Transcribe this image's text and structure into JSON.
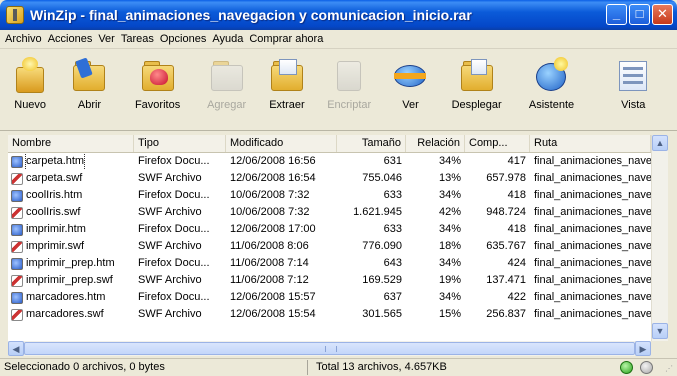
{
  "window": {
    "title": "WinZip - final_animaciones_navegacion y comunicacion_inicio.rar",
    "buttons": [
      "_",
      "□",
      "✕"
    ]
  },
  "menu": [
    "Archivo",
    "Acciones",
    "Ver",
    "Tareas",
    "Opciones",
    "Ayuda",
    "Comprar ahora"
  ],
  "toolbar": [
    {
      "label": "Nuevo",
      "icon": "new-archive-icon",
      "enabled": true
    },
    {
      "label": "Abrir",
      "icon": "open-folder-icon",
      "enabled": true
    },
    {
      "label": "Favoritos",
      "icon": "favorites-heart-icon",
      "enabled": true
    },
    {
      "label": "Agregar",
      "icon": "add-files-icon",
      "enabled": false
    },
    {
      "label": "Extraer",
      "icon": "extract-folder-icon",
      "enabled": true
    },
    {
      "label": "Encriptar",
      "icon": "encrypt-icon",
      "enabled": false
    },
    {
      "label": "Ver",
      "icon": "view-glasses-icon",
      "enabled": true
    },
    {
      "label": "Desplegar",
      "icon": "checkout-icon",
      "enabled": true
    },
    {
      "label": "Asistente",
      "icon": "wizard-icon",
      "enabled": true
    },
    {
      "label": "Vista",
      "icon": "view-layout-icon",
      "enabled": true
    }
  ],
  "columns": [
    "Nombre",
    "Tipo",
    "Modificado",
    "Tamaño",
    "Relación",
    "Comp...",
    "Ruta"
  ],
  "files": [
    {
      "name": "carpeta.htm",
      "type": "Firefox Docu...",
      "modified": "12/06/2008 16:56",
      "size": "631",
      "ratio": "34%",
      "packed": "417",
      "path": "final_animaciones_naveg",
      "kind": "htm"
    },
    {
      "name": "carpeta.swf",
      "type": "SWF Archivo",
      "modified": "12/06/2008 16:54",
      "size": "755.046",
      "ratio": "13%",
      "packed": "657.978",
      "path": "final_animaciones_naveg",
      "kind": "swf"
    },
    {
      "name": "coolIris.htm",
      "type": "Firefox Docu...",
      "modified": "10/06/2008 7:32",
      "size": "633",
      "ratio": "34%",
      "packed": "418",
      "path": "final_animaciones_naveg",
      "kind": "htm"
    },
    {
      "name": "coolIris.swf",
      "type": "SWF Archivo",
      "modified": "10/06/2008 7:32",
      "size": "1.621.945",
      "ratio": "42%",
      "packed": "948.724",
      "path": "final_animaciones_naveg",
      "kind": "swf"
    },
    {
      "name": "imprimir.htm",
      "type": "Firefox Docu...",
      "modified": "12/06/2008 17:00",
      "size": "633",
      "ratio": "34%",
      "packed": "418",
      "path": "final_animaciones_naveg",
      "kind": "htm"
    },
    {
      "name": "imprimir.swf",
      "type": "SWF Archivo",
      "modified": "11/06/2008 8:06",
      "size": "776.090",
      "ratio": "18%",
      "packed": "635.767",
      "path": "final_animaciones_naveg",
      "kind": "swf"
    },
    {
      "name": "imprimir_prep.htm",
      "type": "Firefox Docu...",
      "modified": "11/06/2008 7:14",
      "size": "643",
      "ratio": "34%",
      "packed": "424",
      "path": "final_animaciones_naveg",
      "kind": "htm"
    },
    {
      "name": "imprimir_prep.swf",
      "type": "SWF Archivo",
      "modified": "11/06/2008 7:12",
      "size": "169.529",
      "ratio": "19%",
      "packed": "137.471",
      "path": "final_animaciones_naveg",
      "kind": "swf"
    },
    {
      "name": "marcadores.htm",
      "type": "Firefox Docu...",
      "modified": "12/06/2008 15:57",
      "size": "637",
      "ratio": "34%",
      "packed": "422",
      "path": "final_animaciones_naveg",
      "kind": "htm"
    },
    {
      "name": "marcadores.swf",
      "type": "SWF Archivo",
      "modified": "12/06/2008 15:54",
      "size": "301.565",
      "ratio": "15%",
      "packed": "256.837",
      "path": "final_animaciones_naveg",
      "kind": "swf"
    }
  ],
  "status": {
    "selection": "Seleccionado 0 archivos, 0 bytes",
    "total": "Total 13 archivos, 4.657KB"
  },
  "colors": {
    "titlebar": "#0B5BD9",
    "face": "#ECE9D8",
    "scrollbar": "#C3D6FA"
  }
}
